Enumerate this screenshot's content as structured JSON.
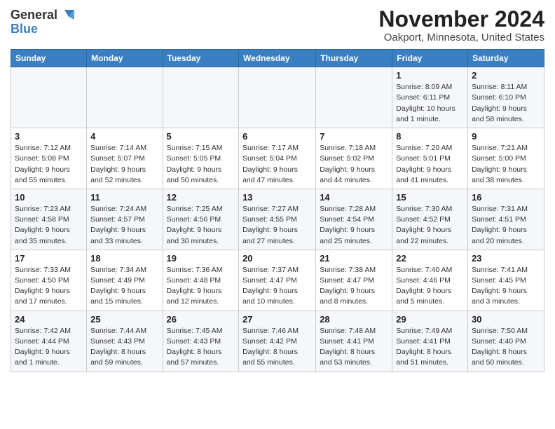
{
  "header": {
    "logo_general": "General",
    "logo_blue": "Blue",
    "title": "November 2024",
    "subtitle": "Oakport, Minnesota, United States"
  },
  "weekdays": [
    "Sunday",
    "Monday",
    "Tuesday",
    "Wednesday",
    "Thursday",
    "Friday",
    "Saturday"
  ],
  "weeks": [
    [
      {
        "day": "",
        "info": ""
      },
      {
        "day": "",
        "info": ""
      },
      {
        "day": "",
        "info": ""
      },
      {
        "day": "",
        "info": ""
      },
      {
        "day": "",
        "info": ""
      },
      {
        "day": "1",
        "info": "Sunrise: 8:09 AM\nSunset: 6:11 PM\nDaylight: 10 hours\nand 1 minute."
      },
      {
        "day": "2",
        "info": "Sunrise: 8:11 AM\nSunset: 6:10 PM\nDaylight: 9 hours\nand 58 minutes."
      }
    ],
    [
      {
        "day": "3",
        "info": "Sunrise: 7:12 AM\nSunset: 5:08 PM\nDaylight: 9 hours\nand 55 minutes."
      },
      {
        "day": "4",
        "info": "Sunrise: 7:14 AM\nSunset: 5:07 PM\nDaylight: 9 hours\nand 52 minutes."
      },
      {
        "day": "5",
        "info": "Sunrise: 7:15 AM\nSunset: 5:05 PM\nDaylight: 9 hours\nand 50 minutes."
      },
      {
        "day": "6",
        "info": "Sunrise: 7:17 AM\nSunset: 5:04 PM\nDaylight: 9 hours\nand 47 minutes."
      },
      {
        "day": "7",
        "info": "Sunrise: 7:18 AM\nSunset: 5:02 PM\nDaylight: 9 hours\nand 44 minutes."
      },
      {
        "day": "8",
        "info": "Sunrise: 7:20 AM\nSunset: 5:01 PM\nDaylight: 9 hours\nand 41 minutes."
      },
      {
        "day": "9",
        "info": "Sunrise: 7:21 AM\nSunset: 5:00 PM\nDaylight: 9 hours\nand 38 minutes."
      }
    ],
    [
      {
        "day": "10",
        "info": "Sunrise: 7:23 AM\nSunset: 4:58 PM\nDaylight: 9 hours\nand 35 minutes."
      },
      {
        "day": "11",
        "info": "Sunrise: 7:24 AM\nSunset: 4:57 PM\nDaylight: 9 hours\nand 33 minutes."
      },
      {
        "day": "12",
        "info": "Sunrise: 7:25 AM\nSunset: 4:56 PM\nDaylight: 9 hours\nand 30 minutes."
      },
      {
        "day": "13",
        "info": "Sunrise: 7:27 AM\nSunset: 4:55 PM\nDaylight: 9 hours\nand 27 minutes."
      },
      {
        "day": "14",
        "info": "Sunrise: 7:28 AM\nSunset: 4:54 PM\nDaylight: 9 hours\nand 25 minutes."
      },
      {
        "day": "15",
        "info": "Sunrise: 7:30 AM\nSunset: 4:52 PM\nDaylight: 9 hours\nand 22 minutes."
      },
      {
        "day": "16",
        "info": "Sunrise: 7:31 AM\nSunset: 4:51 PM\nDaylight: 9 hours\nand 20 minutes."
      }
    ],
    [
      {
        "day": "17",
        "info": "Sunrise: 7:33 AM\nSunset: 4:50 PM\nDaylight: 9 hours\nand 17 minutes."
      },
      {
        "day": "18",
        "info": "Sunrise: 7:34 AM\nSunset: 4:49 PM\nDaylight: 9 hours\nand 15 minutes."
      },
      {
        "day": "19",
        "info": "Sunrise: 7:36 AM\nSunset: 4:48 PM\nDaylight: 9 hours\nand 12 minutes."
      },
      {
        "day": "20",
        "info": "Sunrise: 7:37 AM\nSunset: 4:47 PM\nDaylight: 9 hours\nand 10 minutes."
      },
      {
        "day": "21",
        "info": "Sunrise: 7:38 AM\nSunset: 4:47 PM\nDaylight: 9 hours\nand 8 minutes."
      },
      {
        "day": "22",
        "info": "Sunrise: 7:40 AM\nSunset: 4:46 PM\nDaylight: 9 hours\nand 5 minutes."
      },
      {
        "day": "23",
        "info": "Sunrise: 7:41 AM\nSunset: 4:45 PM\nDaylight: 9 hours\nand 3 minutes."
      }
    ],
    [
      {
        "day": "24",
        "info": "Sunrise: 7:42 AM\nSunset: 4:44 PM\nDaylight: 9 hours\nand 1 minute."
      },
      {
        "day": "25",
        "info": "Sunrise: 7:44 AM\nSunset: 4:43 PM\nDaylight: 8 hours\nand 59 minutes."
      },
      {
        "day": "26",
        "info": "Sunrise: 7:45 AM\nSunset: 4:43 PM\nDaylight: 8 hours\nand 57 minutes."
      },
      {
        "day": "27",
        "info": "Sunrise: 7:46 AM\nSunset: 4:42 PM\nDaylight: 8 hours\nand 55 minutes."
      },
      {
        "day": "28",
        "info": "Sunrise: 7:48 AM\nSunset: 4:41 PM\nDaylight: 8 hours\nand 53 minutes."
      },
      {
        "day": "29",
        "info": "Sunrise: 7:49 AM\nSunset: 4:41 PM\nDaylight: 8 hours\nand 51 minutes."
      },
      {
        "day": "30",
        "info": "Sunrise: 7:50 AM\nSunset: 4:40 PM\nDaylight: 8 hours\nand 50 minutes."
      }
    ]
  ]
}
